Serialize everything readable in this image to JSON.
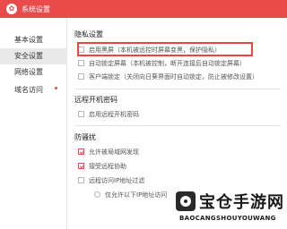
{
  "window": {
    "title": "系统设置"
  },
  "sidebar": {
    "items": [
      {
        "label": "基本设置",
        "active": false,
        "has_dot": false
      },
      {
        "label": "安全设置",
        "active": true,
        "has_dot": false
      },
      {
        "label": "网络设置",
        "active": false,
        "has_dot": false
      },
      {
        "label": "域名访问",
        "active": false,
        "has_dot": true
      }
    ]
  },
  "privacy": {
    "title": "隐私设置",
    "options": [
      {
        "label": "启用黑屏（本机被远控时屏幕变黑，保护隐私）",
        "checked": false
      },
      {
        "label": "自动锁定屏幕（本机被控制，断开连接后自动锁定屏幕）",
        "checked": false
      },
      {
        "label": "客户端锁定（关闭向日葵界面时自动锁定，防止被修改设置）",
        "checked": false
      }
    ]
  },
  "remote_boot": {
    "title": "远程开机密码",
    "options": [
      {
        "label": "启用远程开机密码",
        "checked": false
      }
    ]
  },
  "protection": {
    "title": "防骚扰",
    "options": [
      {
        "label": "允许被局域网发现",
        "checked": true
      },
      {
        "label": "接受远程协助",
        "checked": true
      },
      {
        "label": "远程访问IP地址过滤",
        "checked": false
      }
    ],
    "radio_label": "仅允许以下IP地址访问"
  },
  "watermark": {
    "cn": "宝仓手游网",
    "en": "BAOCANGSHOUYOUWANG"
  },
  "colors": {
    "accent": "#e94b4b",
    "highlight_box": "#e8473a"
  }
}
